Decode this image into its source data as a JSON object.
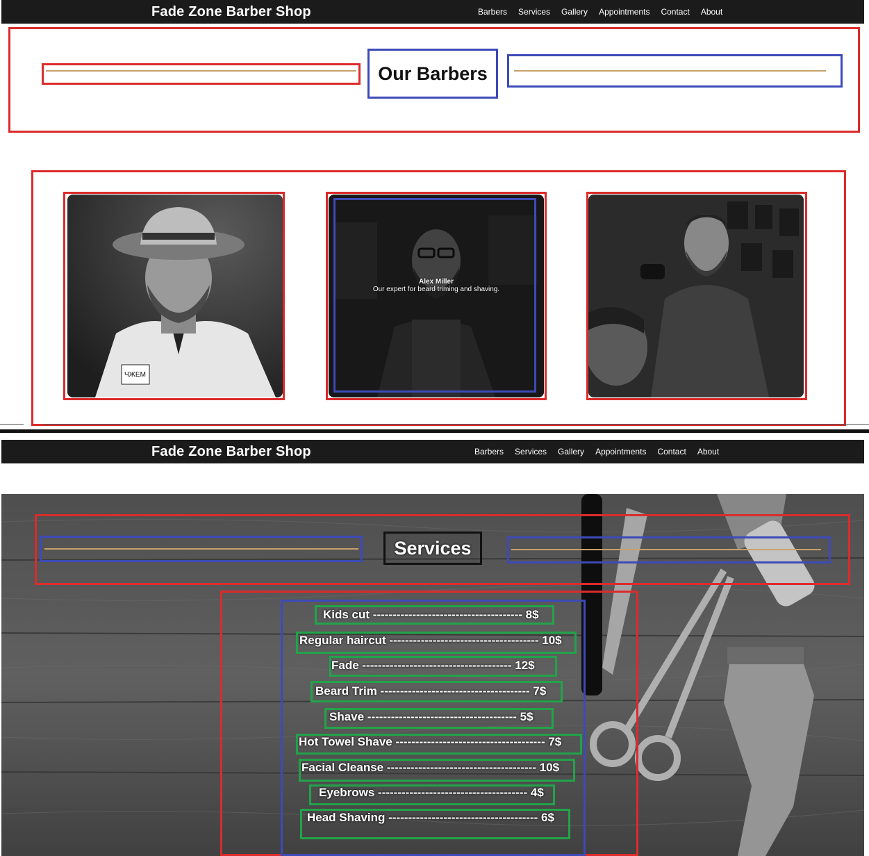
{
  "app": {
    "brand": "Fade Zone Barber Shop",
    "nav": [
      "Barbers",
      "Services",
      "Gallery",
      "Appointments",
      "Contact",
      "About"
    ]
  },
  "barbers_section": {
    "title": "Our Barbers",
    "cards": [
      {
        "photo": "barber-portrait-hat"
      },
      {
        "photo": "barber-portrait-glasses",
        "name": "Alex Miller",
        "caption": "Our expert for beard triming and shaving."
      },
      {
        "photo": "barber-cutting-hair"
      }
    ],
    "coat_patch_text": "ЧЖЕМ"
  },
  "services_section": {
    "title": "Services",
    "items": [
      {
        "label": "Kids cut -------------------------------------- 8$"
      },
      {
        "label": "Regular haircut -------------------------------------- 10$"
      },
      {
        "label": "Fade -------------------------------------- 12$"
      },
      {
        "label": "Beard Trim -------------------------------------- 7$"
      },
      {
        "label": "Shave -------------------------------------- 5$"
      },
      {
        "label": "Hot Towel Shave -------------------------------------- 7$"
      },
      {
        "label": "Facial Cleanse -------------------------------------- 10$"
      },
      {
        "label": "Eyebrows -------------------------------------- 4$"
      },
      {
        "label": "Head Shaving -------------------------------------- 6$"
      }
    ]
  },
  "colors": {
    "nav_bg": "#1b1b1b",
    "accent_line": "#c6a26c",
    "outline_red": "#dc2b2b",
    "outline_blue": "#3d4ab8",
    "outline_green": "#22a34a"
  }
}
